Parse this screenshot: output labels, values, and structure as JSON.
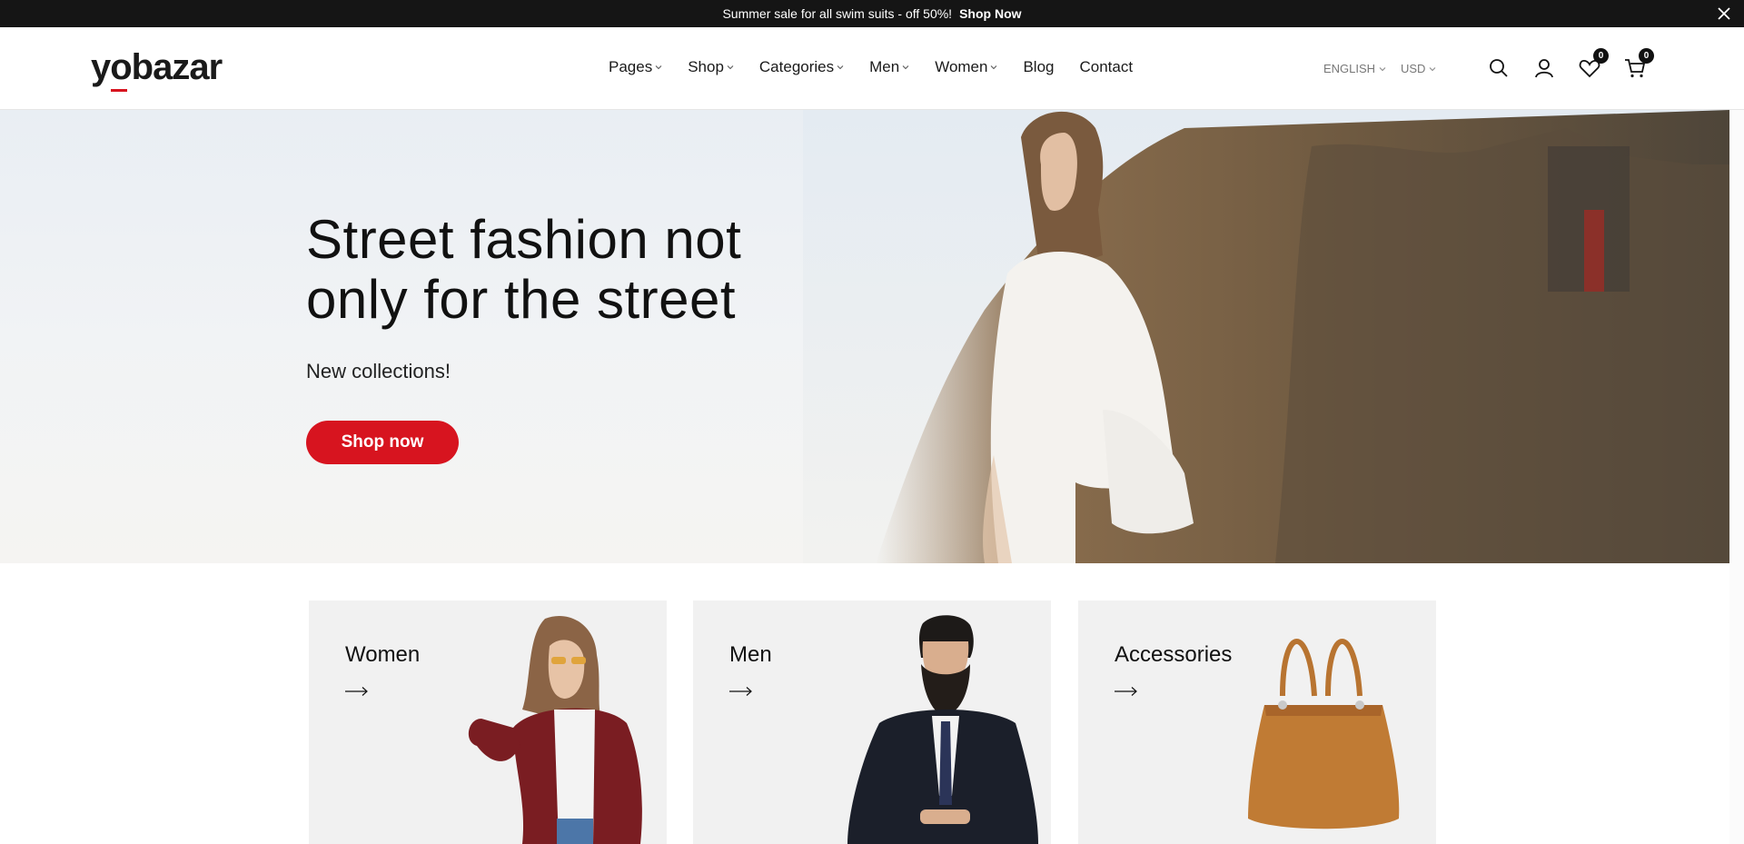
{
  "announcement": {
    "message": "Summer sale for all swim suits - off 50%!",
    "link": "Shop Now"
  },
  "logo": "yobazar",
  "nav": [
    {
      "label": "Pages",
      "dropdown": true
    },
    {
      "label": "Shop",
      "dropdown": true
    },
    {
      "label": "Categories",
      "dropdown": true
    },
    {
      "label": "Men",
      "dropdown": true
    },
    {
      "label": "Women",
      "dropdown": true
    },
    {
      "label": "Blog",
      "dropdown": false
    },
    {
      "label": "Contact",
      "dropdown": false
    }
  ],
  "locale": {
    "language": "ENGLISH",
    "currency": "USD"
  },
  "header_icons": {
    "search": "search-icon",
    "account": "user-icon",
    "wishlist": "heart-icon",
    "cart": "cart-icon"
  },
  "counts": {
    "wishlist": "0",
    "cart": "0"
  },
  "hero": {
    "title_line1": "Street fashion not",
    "title_line2": "only for the street",
    "subtitle": "New collections!",
    "cta": "Shop now"
  },
  "categories": [
    {
      "label": "Women"
    },
    {
      "label": "Men"
    },
    {
      "label": "Accessories"
    }
  ],
  "colors": {
    "accent": "#d7141f",
    "dark": "#151515",
    "card": "#f1f1f1"
  }
}
